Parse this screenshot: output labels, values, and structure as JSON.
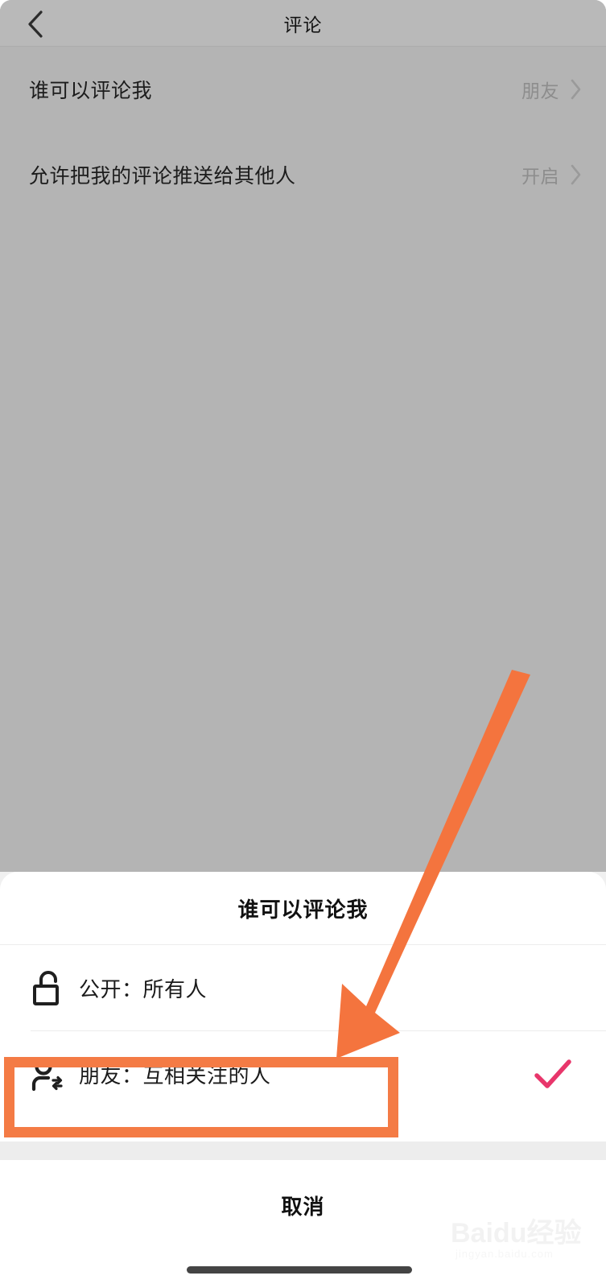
{
  "navbar": {
    "back_icon": "chevron-left-icon",
    "title": "评论"
  },
  "settings_list": {
    "rows": [
      {
        "label": "谁可以评论我",
        "value": "朋友",
        "chevron": "chevron-right-icon"
      },
      {
        "label": "允许把我的评论推送给其他人",
        "value": "开启",
        "chevron": "chevron-right-icon"
      }
    ]
  },
  "action_sheet": {
    "title": "谁可以评论我",
    "options": [
      {
        "icon": "unlock-icon",
        "label": "公开：所有人",
        "selected": false
      },
      {
        "icon": "mutual-follow-person-icon",
        "label": "朋友：互相关注的人",
        "selected": true,
        "check_icon": "check-icon"
      }
    ],
    "cancel_label": "取消"
  },
  "annotations": {
    "arrow": {
      "name": "orange-pointer-arrow",
      "color": "#f4743e"
    },
    "highlight_box": {
      "name": "orange-highlight-box",
      "color": "#f47b45"
    }
  },
  "watermark": {
    "brand": "Baidu经验",
    "url": "jingyan.baidu.com"
  },
  "colors": {
    "dim_overlay": "#b4b4b4",
    "navbar": "#b9b9b9",
    "sheet_bg": "#ffffff",
    "accent_check": "#e8366b",
    "annotation_orange": "#f4743e",
    "home_indicator": "#444444"
  }
}
